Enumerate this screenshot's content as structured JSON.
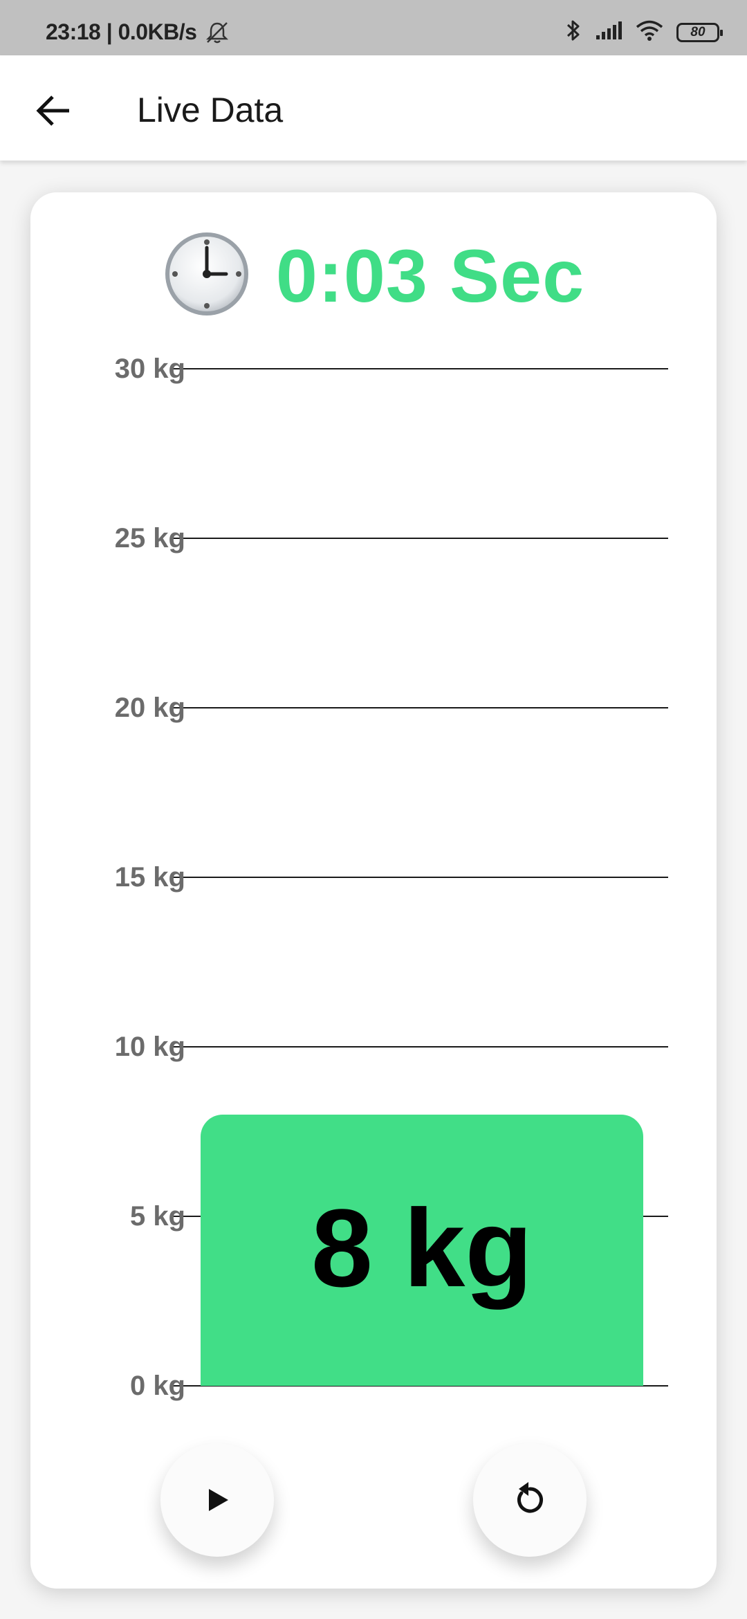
{
  "status_bar": {
    "time": "23:18 | 0.0KB/s",
    "battery": "80",
    "icons": [
      "mute-bell-icon",
      "bluetooth-icon",
      "signal-icon",
      "wifi-icon",
      "battery-icon"
    ]
  },
  "app_bar": {
    "title": "Live Data",
    "back_icon": "arrow-left-icon"
  },
  "timer": {
    "icon": "clock-icon",
    "text": "0:03 Sec",
    "color": "#40dd86"
  },
  "chart_data": {
    "type": "bar",
    "categories": [
      ""
    ],
    "values": [
      8
    ],
    "value_labels": [
      "8 kg"
    ],
    "tick_labels": [
      "0 kg",
      "5 kg",
      "10 kg",
      "15 kg",
      "20 kg",
      "25 kg",
      "30 kg"
    ],
    "ticks": [
      0,
      5,
      10,
      15,
      20,
      25,
      30
    ],
    "ylim": [
      0,
      30
    ],
    "grid": true,
    "bar_color": "#41de87"
  },
  "controls": {
    "play_icon": "play-icon",
    "reset_icon": "reset-icon"
  }
}
